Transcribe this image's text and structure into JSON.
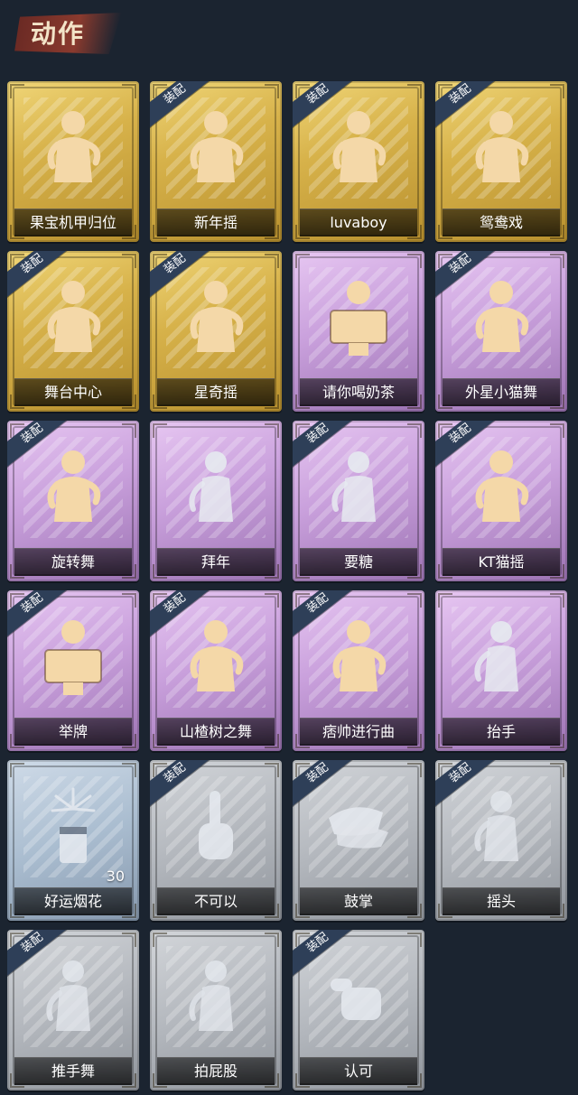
{
  "header": {
    "title": "动作"
  },
  "labels": {
    "equipped": "装配"
  },
  "colors": {
    "gold": "#d7b24a",
    "purple": "#c9a0dc",
    "blue": "#aabdd0",
    "grey": "#b3b7bd",
    "figure_gold": "#f4d8a8",
    "figure_pale": "#e6eaf0"
  },
  "items": [
    {
      "name": "果宝机甲归位",
      "rarity": "gold",
      "equipped": false,
      "icon": "dancer-figure-icon"
    },
    {
      "name": "新年摇",
      "rarity": "gold",
      "equipped": true,
      "icon": "dancer-figure-icon"
    },
    {
      "name": "luvaboy",
      "rarity": "gold",
      "equipped": true,
      "icon": "dancer-figure-icon"
    },
    {
      "name": "鸳鸯戏",
      "rarity": "gold",
      "equipped": true,
      "icon": "dancer-figure-icon"
    },
    {
      "name": "舞台中心",
      "rarity": "gold",
      "equipped": true,
      "icon": "dancer-figure-icon"
    },
    {
      "name": "星奇摇",
      "rarity": "gold",
      "equipped": true,
      "icon": "dancer-figure-icon"
    },
    {
      "name": "请你喝奶茶",
      "rarity": "purple",
      "equipped": false,
      "icon": "sign-figure-icon"
    },
    {
      "name": "外星小猫舞",
      "rarity": "purple",
      "equipped": true,
      "icon": "dancer-figure-icon"
    },
    {
      "name": "旋转舞",
      "rarity": "purple",
      "equipped": true,
      "icon": "dancer-figure-icon"
    },
    {
      "name": "拜年",
      "rarity": "purple",
      "equipped": false,
      "icon": "pale-figure-icon"
    },
    {
      "name": "要糖",
      "rarity": "purple",
      "equipped": true,
      "icon": "pale-figure-icon"
    },
    {
      "name": "KT猫摇",
      "rarity": "purple",
      "equipped": true,
      "icon": "dancer-figure-icon"
    },
    {
      "name": "举牌",
      "rarity": "purple",
      "equipped": true,
      "icon": "sign-figure-icon"
    },
    {
      "name": "山楂树之舞",
      "rarity": "purple",
      "equipped": true,
      "icon": "dancer-figure-icon"
    },
    {
      "name": "痞帅进行曲",
      "rarity": "purple",
      "equipped": true,
      "icon": "dancer-figure-icon"
    },
    {
      "name": "抬手",
      "rarity": "purple",
      "equipped": false,
      "icon": "pale-figure-icon"
    },
    {
      "name": "好运烟花",
      "rarity": "blue",
      "equipped": false,
      "icon": "firework-icon",
      "count": "30"
    },
    {
      "name": "不可以",
      "rarity": "grey",
      "equipped": true,
      "icon": "finger-icon"
    },
    {
      "name": "鼓掌",
      "rarity": "grey",
      "equipped": true,
      "icon": "clap-icon"
    },
    {
      "name": "摇头",
      "rarity": "grey",
      "equipped": true,
      "icon": "pale-figure-icon"
    },
    {
      "name": "推手舞",
      "rarity": "grey",
      "equipped": true,
      "icon": "pale-figure-icon"
    },
    {
      "name": "拍屁股",
      "rarity": "grey",
      "equipped": false,
      "icon": "pale-figure-icon"
    },
    {
      "name": "认可",
      "rarity": "grey",
      "equipped": true,
      "icon": "thumb-icon"
    }
  ]
}
